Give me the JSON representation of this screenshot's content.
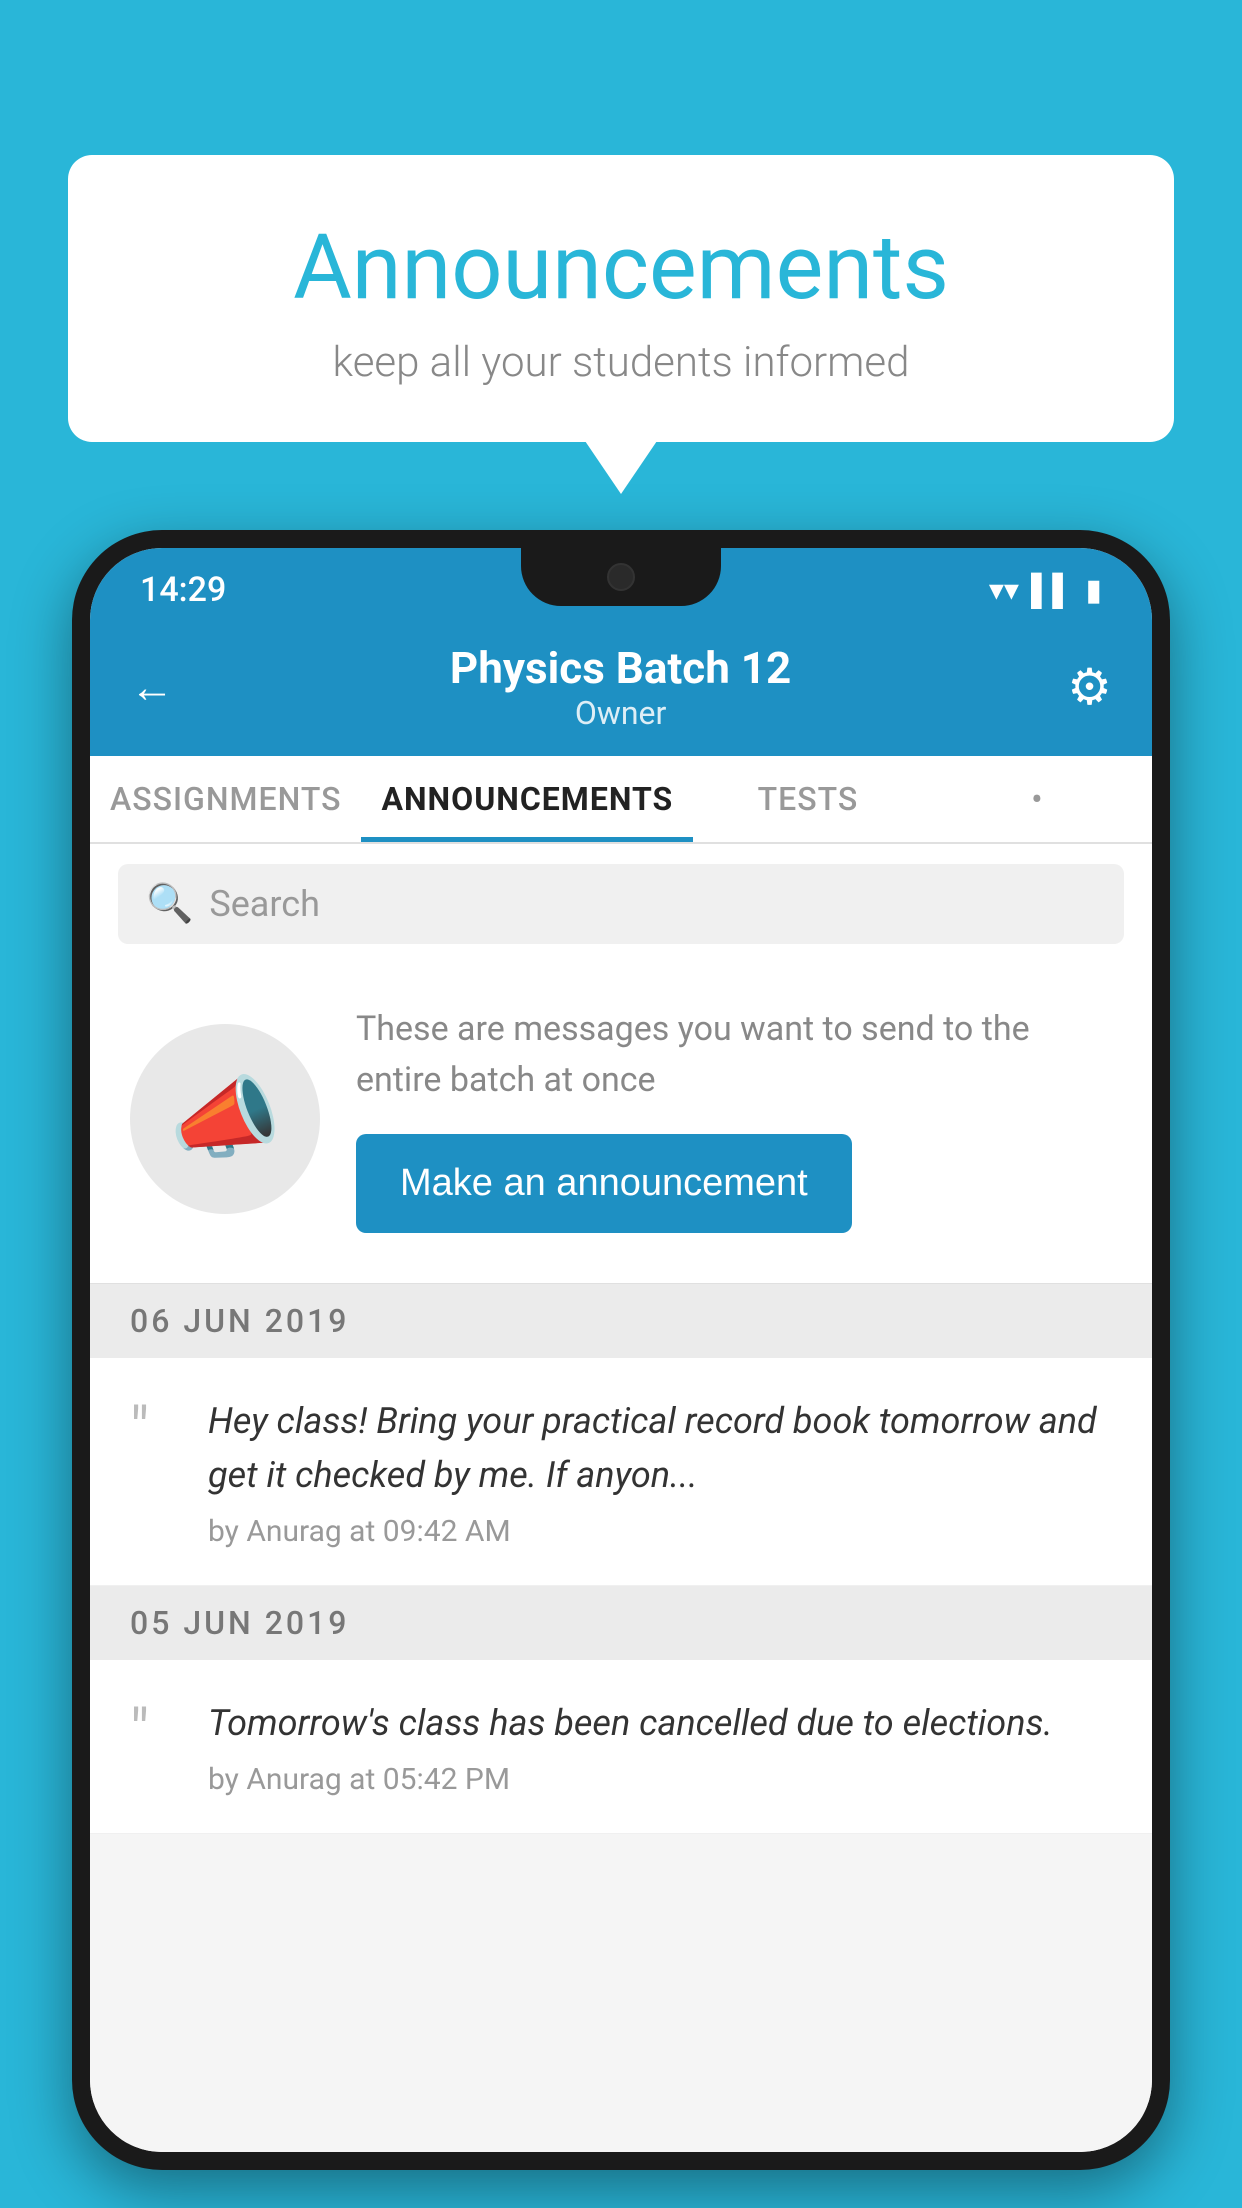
{
  "page": {
    "background_color": "#29b6d8"
  },
  "speech_bubble": {
    "title": "Announcements",
    "subtitle": "keep all your students informed"
  },
  "status_bar": {
    "time": "14:29",
    "icons": [
      "wifi",
      "signal",
      "battery"
    ]
  },
  "app_header": {
    "back_label": "←",
    "title": "Physics Batch 12",
    "subtitle": "Owner",
    "gear_label": "⚙"
  },
  "tabs": {
    "items": [
      {
        "label": "ASSIGNMENTS",
        "active": false
      },
      {
        "label": "ANNOUNCEMENTS",
        "active": true
      },
      {
        "label": "TESTS",
        "active": false
      },
      {
        "label": "•",
        "active": false
      }
    ]
  },
  "search": {
    "placeholder": "Search",
    "icon": "🔍"
  },
  "promo_card": {
    "description": "These are messages you want to send to the entire batch at once",
    "button_label": "Make an announcement"
  },
  "announcements": {
    "groups": [
      {
        "date": "06  JUN  2019",
        "items": [
          {
            "text": "Hey class! Bring your practical record book tomorrow and get it checked by me. If anyon...",
            "meta": "by Anurag at 09:42 AM"
          }
        ]
      },
      {
        "date": "05  JUN  2019",
        "items": [
          {
            "text": "Tomorrow's class has been cancelled due to elections.",
            "meta": "by Anurag at 05:42 PM"
          }
        ]
      }
    ]
  }
}
